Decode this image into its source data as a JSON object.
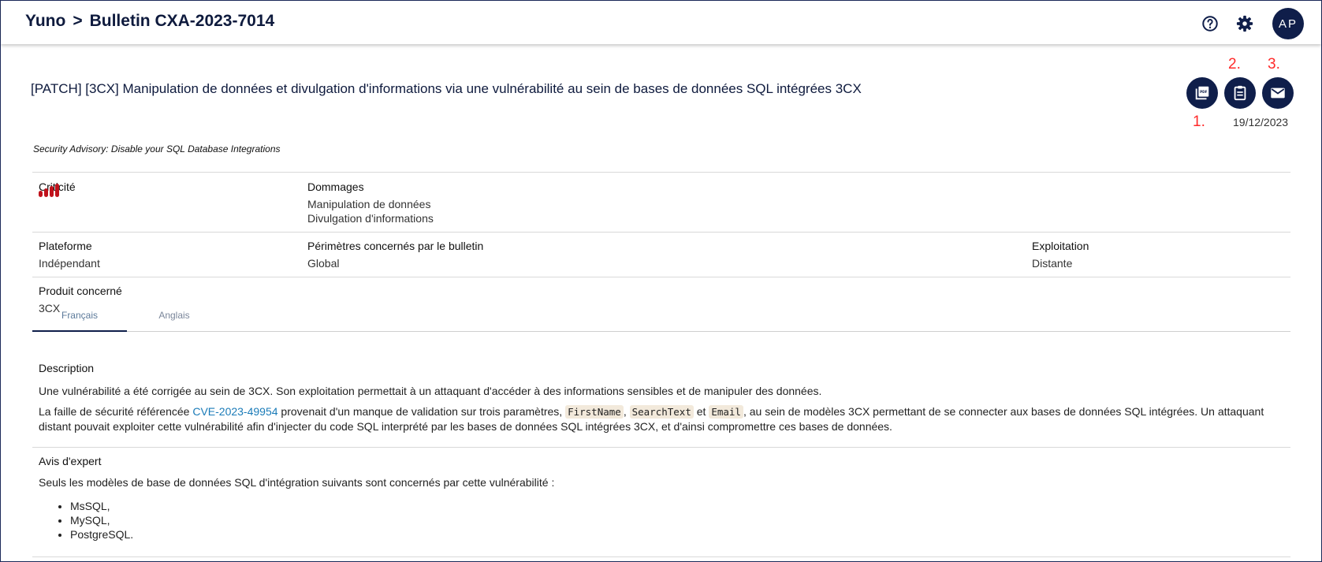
{
  "header": {
    "app_name": "Yuno",
    "separator": ">",
    "page_name": "Bulletin CXA-2023-7014",
    "avatar_initials": "AP"
  },
  "bulletin": {
    "title": "[PATCH] [3CX] Manipulation de données et divulgation d'informations via une vulnérabilité au sein de bases de données SQL intégrées 3CX",
    "date": "19/12/2023",
    "subtitle": "Security Advisory: Disable your SQL Database Integrations",
    "annotations": [
      "1.",
      "2.",
      "3."
    ],
    "actions": [
      "pdf-icon",
      "clipboard-icon",
      "mail-icon"
    ]
  },
  "fields": {
    "criticity_label": "Criticité",
    "criticity_level": 4,
    "criticity_color": "#c0121c",
    "damages_label": "Dommages",
    "damages": [
      "Manipulation de données",
      "Divulgation d'informations"
    ],
    "platform_label": "Plateforme",
    "platform_value": "Indépendant",
    "perimeter_label": "Périmètres concernés par le bulletin",
    "perimeter_value": "Global",
    "exploitation_label": "Exploitation",
    "exploitation_value": "Distante",
    "product_label": "Produit concerné",
    "product_value": "3CX"
  },
  "tabs": [
    "Français",
    "Anglais"
  ],
  "description": {
    "title": "Description",
    "para1": "Une vulnérabilité a été corrigée au sein de 3CX. Son exploitation permettait à un attaquant d'accéder à des informations sensibles et de manipuler des données.",
    "para2_pre": "La faille de sécurité référencée ",
    "cve_link": "CVE-2023-49954",
    "para2_mid1": " provenait d'un manque de validation sur trois paramètres, ",
    "code1": "FirstName",
    "comma": ", ",
    "code2": "SearchText",
    "et": " et ",
    "code3": "Email",
    "para2_post": ", au sein de modèles 3CX permettant de se connecter aux bases de données SQL intégrées. Un attaquant distant pouvait exploiter cette vulnérabilité afin d'injecter du code SQL interprété par les bases de données SQL intégrées 3CX, et d'ainsi compromettre ces bases de données."
  },
  "expert": {
    "title": "Avis d'expert",
    "intro": "Seuls les modèles de base de données SQL d'intégration suivants sont concernés par cette vulnérabilité :",
    "items": [
      "MsSQL,",
      "MySQL,",
      "PostgreSQL."
    ]
  }
}
